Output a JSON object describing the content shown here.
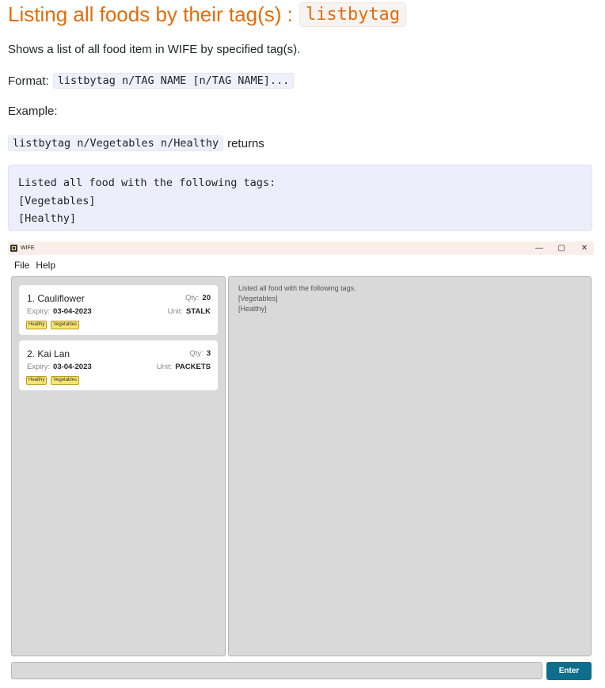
{
  "heading": {
    "text": "Listing all foods by their tag(s) :",
    "command": "listbytag"
  },
  "description": "Shows a list of all food item in WIFE by specified tag(s).",
  "format": {
    "label": "Format:",
    "code": "listbytag n/TAG NAME [n/TAG NAME]..."
  },
  "example": {
    "label": "Example:",
    "code": "listbytag n/Vegetables n/Healthy",
    "suffix": "returns",
    "output": "Listed all food with the following tags:\n[Vegetables]\n[Healthy]"
  },
  "app": {
    "title": "WIFE",
    "window_controls": {
      "minimize": "—",
      "maximize": "▢",
      "close": "✕"
    },
    "menu": [
      "File",
      "Help"
    ],
    "foods": [
      {
        "index_name": "1.  Cauliflower",
        "qty_label": "Qty:",
        "qty": "20",
        "expiry_label": "Expiry:",
        "expiry": "03-04-2023",
        "unit_label": "Unit:",
        "unit": "STALK",
        "tags": [
          "Healthy",
          "Vegetables"
        ]
      },
      {
        "index_name": "2.  Kai Lan",
        "qty_label": "Qty:",
        "qty": "3",
        "expiry_label": "Expiry:",
        "expiry": "03-04-2023",
        "unit_label": "Unit:",
        "unit": "PACKETS",
        "tags": [
          "Healthy",
          "Vegetables"
        ]
      }
    ],
    "result_lines": [
      "Listed all food with the following tags.",
      "[Vegetables]",
      "[Healthy]"
    ],
    "command_input_value": "",
    "enter_label": "Enter",
    "colors": {
      "accent": "#0f6e8c",
      "tag": "#f8e570",
      "heading": "#e46c0a"
    }
  }
}
